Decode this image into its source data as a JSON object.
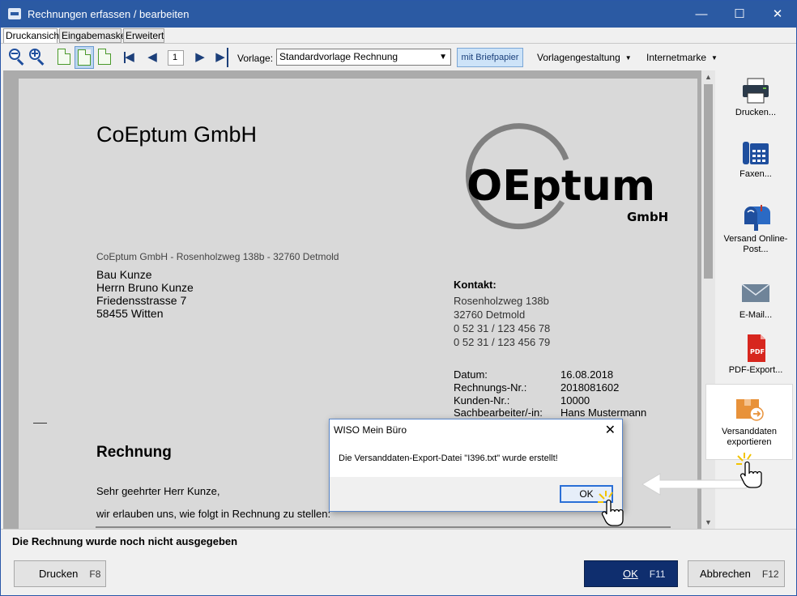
{
  "window": {
    "title": "Rechnungen erfassen / bearbeiten",
    "minimize": "—",
    "maximize": "☐",
    "close": "✕"
  },
  "tabs": [
    {
      "label": "Druckansicht"
    },
    {
      "label": "Eingabemaske"
    },
    {
      "label": "Erweitert"
    }
  ],
  "toolbar": {
    "page_number": "1",
    "vorlage_label": "Vorlage:",
    "vorlage_value": "Standardvorlage Rechnung",
    "briefpapier": "mit Briefpapier",
    "vorlagengestaltung": "Vorlagengestaltung",
    "internetmarke": "Internetmarke",
    "first_icon": "◀",
    "prev_icon": "◀",
    "next_icon": "▶",
    "last_icon": "▶"
  },
  "document": {
    "company": "CoEptum GmbH",
    "logo_text": "OEptum",
    "logo_sub": "GmbH",
    "sender_line": "CoEptum GmbH - Rosenholzweg 138b - 32760 Detmold",
    "recipient": [
      "Bau Kunze",
      "Herrn Bruno Kunze",
      "Friedensstrasse 7",
      "58455 Witten"
    ],
    "contact_heading": "Kontakt:",
    "contact": [
      "Rosenholzweg 138b",
      "32760 Detmold",
      "0 52 31 / 123 456 78",
      "0 52 31 / 123 456 79"
    ],
    "meta": [
      {
        "label": "Datum:",
        "value": "16.08.2018"
      },
      {
        "label": "Rechnungs-Nr.:",
        "value": "2018081602"
      },
      {
        "label": "Kunden-Nr.:",
        "value": "10000"
      },
      {
        "label": "Sachbearbeiter/-in:",
        "value": "Hans Mustermann"
      }
    ],
    "heading": "Rechnung",
    "salutation": "Sehr geehrter Herr Kunze,",
    "intro": "wir erlauben uns, wie folgt in Rechnung zu stellen:"
  },
  "sidebar": [
    {
      "label": "Drucken...",
      "icon": "printer-icon"
    },
    {
      "label": "Faxen...",
      "icon": "fax-icon"
    },
    {
      "label": "Versand Online-Post...",
      "icon": "mailbox-icon"
    },
    {
      "label": "E-Mail...",
      "icon": "envelope-icon"
    },
    {
      "label": "PDF-Export...",
      "icon": "pdf-icon"
    },
    {
      "label": "Versanddaten exportieren",
      "icon": "package-export-icon"
    }
  ],
  "pdf_badge": "PDF",
  "status": "Die Rechnung wurde noch nicht ausgegeben",
  "footer": {
    "drucken": "Drucken",
    "drucken_key": "F8",
    "ok": "OK",
    "ok_key": "F11",
    "abbrechen": "Abbrechen",
    "abbrechen_key": "F12"
  },
  "dialog": {
    "title": "WISO Mein Büro",
    "close": "✕",
    "message": "Die Versanddaten-Export-Datei \"I396.txt\" wurde erstellt!",
    "ok": "OK"
  },
  "colors": {
    "titlebar": "#2b5aa3",
    "primary_button": "#0f2e6e",
    "briefpapier_bg": "#cde3f8"
  }
}
